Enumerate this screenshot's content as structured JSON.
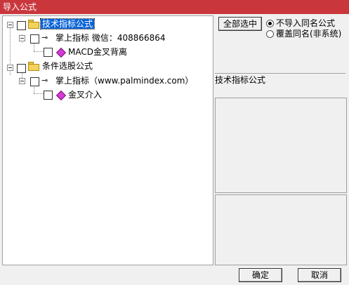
{
  "window": {
    "title": "导入公式"
  },
  "tree": {
    "nodes": [
      {
        "label": "技术指标公式",
        "selected": true
      },
      {
        "label": "掌上指标 微信：408866864"
      },
      {
        "label": "MACD金叉背离"
      },
      {
        "label": "条件选股公式"
      },
      {
        "label": "掌上指标（www.palmindex.com）"
      },
      {
        "label": "金叉介入"
      }
    ]
  },
  "options": {
    "select_all_label": "全部选中",
    "radio_no_import": "不导入同名公式",
    "radio_overwrite": "覆盖同名(非系统)"
  },
  "preview": {
    "caption": "技术指标公式"
  },
  "footer": {
    "ok_label": "确定",
    "cancel_label": "取消"
  }
}
